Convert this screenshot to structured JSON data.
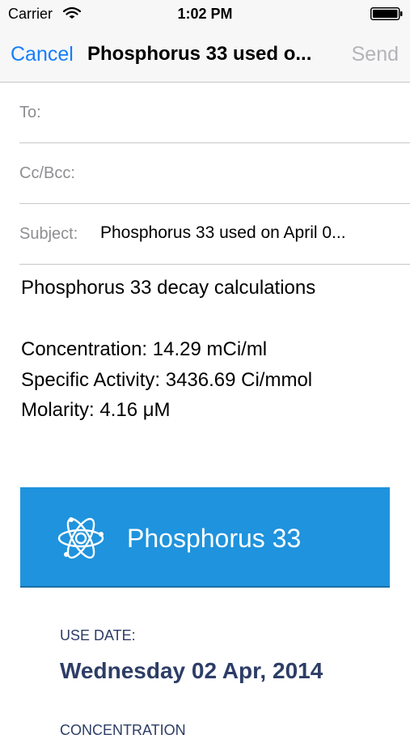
{
  "status_bar": {
    "carrier": "Carrier",
    "time": "1:02 PM",
    "icons": [
      "wifi-icon",
      "battery-icon"
    ]
  },
  "nav": {
    "cancel_label": "Cancel",
    "title": "Phosphorus 33 used o...",
    "send_label": "Send"
  },
  "fields": {
    "to_label": "To:",
    "cc_bcc_label": "Cc/Bcc:",
    "subject_label": "Subject:",
    "subject_value": "Phosphorus 33 used on April 0..."
  },
  "body": {
    "heading": "Phosphorus 33 decay calculations",
    "concentration": "Concentration: 14.29 mCi/ml",
    "specific_activity": "Specific Activity: 3436.69 Ci/mmol",
    "molarity": "Molarity: 4.16 μM"
  },
  "banner": {
    "icon": "atom-icon",
    "title": "Phosphorus 33"
  },
  "details": {
    "use_date_label": "USE DATE:",
    "use_date_value": "Wednesday 02 Apr, 2014",
    "next_label": "CONCENTRATION"
  },
  "colors": {
    "accent": "#157efb",
    "disabled": "#b3b3b8",
    "banner": "#1f93dd",
    "detail_text": "#2d3d66"
  }
}
